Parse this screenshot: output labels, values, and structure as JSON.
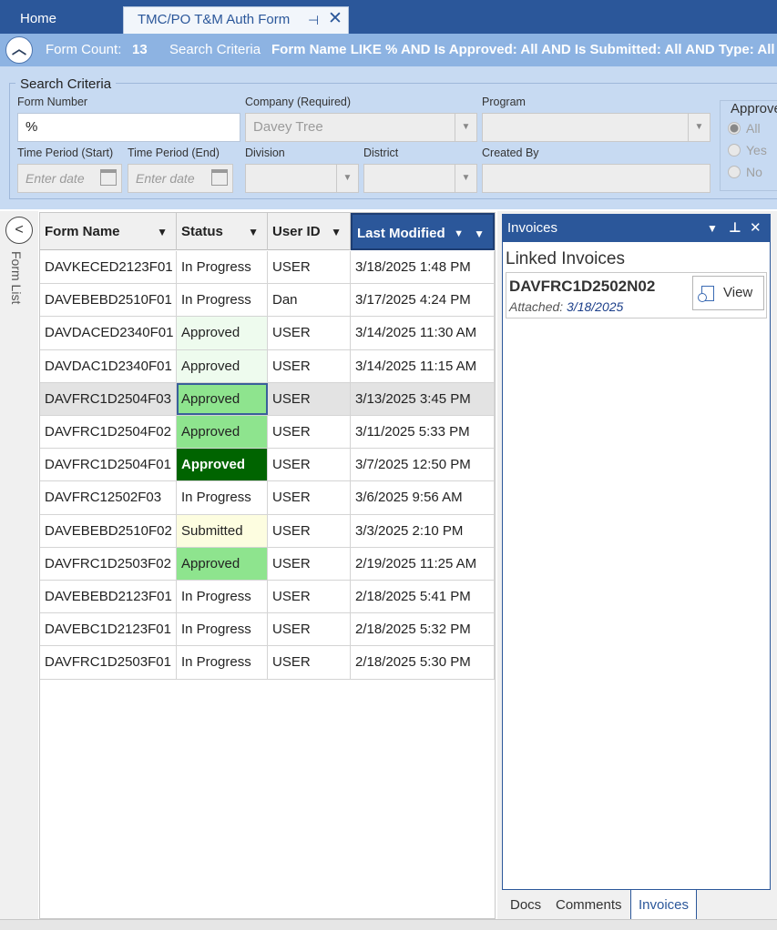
{
  "tabs": {
    "home": "Home",
    "active": "TMC/PO T&M Auth Form",
    "pin_glyph": "⊣",
    "close_glyph": "✕"
  },
  "summary": {
    "form_count_label": "Form Count:",
    "form_count_value": "13",
    "search_criteria_label": "Search Criteria",
    "search_criteria_value": "Form Name LIKE % AND Is Approved: All AND Is Submitted: All AND Type: All"
  },
  "criteria": {
    "legend": "Search Criteria",
    "form_number_label": "Form Number",
    "form_number_value": "%",
    "company_label": "Company (Required)",
    "company_value": "Davey Tree",
    "program_label": "Program",
    "program_value": "",
    "time_start_label": "Time Period (Start)",
    "time_start_placeholder": "Enter date",
    "time_end_label": "Time Period (End)",
    "time_end_placeholder": "Enter date",
    "division_label": "Division",
    "district_label": "District",
    "created_by_label": "Created By",
    "approved_label": "Approved",
    "approved_options": [
      "All",
      "Yes",
      "No"
    ],
    "approved_selected": "All"
  },
  "sidebar": {
    "collapse_glyph": "<",
    "label": "Form List"
  },
  "grid": {
    "columns": [
      "Form Name",
      "Status",
      "User ID",
      "Last Modified"
    ],
    "sorted_column": "Last Modified",
    "rows": [
      {
        "form": "DAVKECED2123F01",
        "status": "In Progress",
        "user": "USER",
        "modified": "3/18/2025 1:48 PM",
        "style": ""
      },
      {
        "form": "DAVEBEBD2510F01",
        "status": "In Progress",
        "user": "Dan",
        "modified": "3/17/2025 4:24 PM",
        "style": ""
      },
      {
        "form": "DAVDACED2340F01",
        "status": "Approved",
        "user": "USER",
        "modified": "3/14/2025 11:30 AM",
        "style": "light"
      },
      {
        "form": "DAVDAC1D2340F01",
        "status": "Approved",
        "user": "USER",
        "modified": "3/14/2025 11:15 AM",
        "style": "light"
      },
      {
        "form": "DAVFRC1D2504F03",
        "status": "Approved",
        "user": "USER",
        "modified": "3/13/2025 3:45 PM",
        "style": "selected"
      },
      {
        "form": "DAVFRC1D2504F02",
        "status": "Approved",
        "user": "USER",
        "modified": "3/11/2025 5:33 PM",
        "style": "green"
      },
      {
        "form": "DAVFRC1D2504F01",
        "status": "Approved",
        "user": "USER",
        "modified": "3/7/2025 12:50 PM",
        "style": "dark"
      },
      {
        "form": "DAVFRC12502F03",
        "status": "In Progress",
        "user": "USER",
        "modified": "3/6/2025 9:56 AM",
        "style": ""
      },
      {
        "form": "DAVEBEBD2510F02",
        "status": "Submitted",
        "user": "USER",
        "modified": "3/3/2025 2:10 PM",
        "style": "submitted"
      },
      {
        "form": "DAVFRC1D2503F02",
        "status": "Approved",
        "user": "USER",
        "modified": "2/19/2025 11:25 AM",
        "style": "green"
      },
      {
        "form": "DAVEBEBD2123F01",
        "status": "In Progress",
        "user": "USER",
        "modified": "2/18/2025 5:41 PM",
        "style": ""
      },
      {
        "form": "DAVEBC1D2123F01",
        "status": "In Progress",
        "user": "USER",
        "modified": "2/18/2025 5:32 PM",
        "style": ""
      },
      {
        "form": "DAVFRC1D2503F01",
        "status": "In Progress",
        "user": "USER",
        "modified": "2/18/2025 5:30 PM",
        "style": ""
      }
    ]
  },
  "invoices": {
    "panel_title": "Invoices",
    "section_title": "Linked Invoices",
    "invoice_number": "DAVFRC1D2502N02",
    "attached_label": "Attached:",
    "attached_date": "3/18/2025",
    "view_label": "View"
  },
  "bottom_tabs": [
    "Docs",
    "Comments",
    "Invoices"
  ],
  "active_bottom_tab": "Invoices",
  "colors": {
    "brand": "#2b579a",
    "approved": "#8ee48e",
    "approved_dark": "#006400",
    "submitted": "#fdfde0"
  }
}
